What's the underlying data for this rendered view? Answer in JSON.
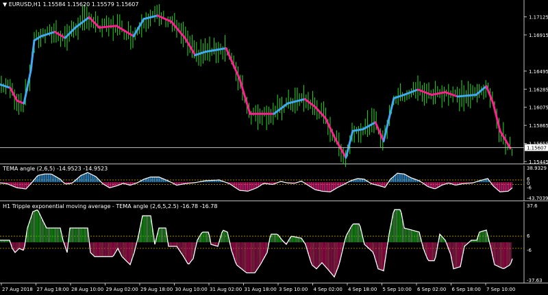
{
  "header": {
    "symbol_text": "EURUSD,H1",
    "ohlc_text": "1.15584 1.15620 1.15579 1.15607"
  },
  "main_panel": {
    "price_ticks": [
      "1.17125",
      "1.16915",
      "1.16495",
      "1.16285",
      "1.16075",
      "1.15865",
      "1.15655",
      "1.15445"
    ],
    "current_price_label": "1.15607",
    "colors": {
      "bull": "#3fa9f5",
      "bear": "#ff1f8e",
      "bars": "#22dd22"
    }
  },
  "indicator1": {
    "title": "TEMA angle (2,6,5)",
    "values_text": "-14.9523 -14.9523",
    "scale_labels": [
      "38.9329",
      "6",
      "0",
      "-6",
      "-43.7039"
    ],
    "colors": {
      "pos": "#3fa9f5",
      "neg": "#ff1f8e"
    }
  },
  "indicator2": {
    "title": "H1 Tripple exponential moving average - TEMA angle (2,6,5,2.5)",
    "values_text": "-16.78 -16.78",
    "scale_labels": [
      "37.6",
      "6",
      "-6",
      "-37.63"
    ],
    "colors": {
      "pos": "#22cc22",
      "neg": "#e01070"
    }
  },
  "time_axis": {
    "labels": [
      "27 Aug 2018",
      "27 Aug 18:00",
      "28 Aug 10:00",
      "29 Aug 02:00",
      "29 Aug 18:00",
      "30 Aug 10:00",
      "31 Aug 02:00",
      "31 Aug 18:00",
      "3 Sep 10:00",
      "4 Sep 02:00",
      "4 Sep 18:00",
      "5 Sep 10:00",
      "6 Sep 02:00",
      "6 Sep 18:00",
      "7 Sep 10:00"
    ]
  },
  "chart_data": {
    "type": "line",
    "price_series": [
      [
        0,
        1.1634
      ],
      [
        15,
        1.163
      ],
      [
        25,
        1.1615
      ],
      [
        35,
        1.1612
      ],
      [
        45,
        1.165
      ],
      [
        50,
        1.1685
      ],
      [
        60,
        1.169
      ],
      [
        80,
        1.1695
      ],
      [
        95,
        1.1688
      ],
      [
        110,
        1.17
      ],
      [
        130,
        1.1712
      ],
      [
        145,
        1.17
      ],
      [
        170,
        1.1702
      ],
      [
        195,
        1.169
      ],
      [
        210,
        1.171
      ],
      [
        230,
        1.1714
      ],
      [
        250,
        1.1707
      ],
      [
        270,
        1.1688
      ],
      [
        285,
        1.1668
      ],
      [
        300,
        1.1672
      ],
      [
        330,
        1.1676
      ],
      [
        350,
        1.164
      ],
      [
        365,
        1.16
      ],
      [
        400,
        1.16
      ],
      [
        420,
        1.1612
      ],
      [
        445,
        1.1617
      ],
      [
        460,
        1.1608
      ],
      [
        475,
        1.1595
      ],
      [
        490,
        1.157
      ],
      [
        505,
        1.1549
      ],
      [
        515,
        1.158
      ],
      [
        530,
        1.1582
      ],
      [
        548,
        1.159
      ],
      [
        560,
        1.1568
      ],
      [
        575,
        1.1618
      ],
      [
        590,
        1.1622
      ],
      [
        610,
        1.1628
      ],
      [
        630,
        1.1622
      ],
      [
        650,
        1.1625
      ],
      [
        668,
        1.162
      ],
      [
        695,
        1.1622
      ],
      [
        710,
        1.1632
      ],
      [
        720,
        1.1612
      ],
      [
        730,
        1.158
      ],
      [
        745,
        1.156
      ]
    ],
    "price_colors": [
      "bull",
      "bull",
      "bear",
      "bear",
      "bull",
      "bull",
      "bull",
      "bull",
      "bear",
      "bull",
      "bull",
      "bear",
      "bear",
      "bear",
      "bull",
      "bull",
      "bear",
      "bear",
      "bear",
      "bull",
      "bull",
      "bear",
      "bear",
      "bear",
      "bull",
      "bull",
      "bear",
      "bear",
      "bear",
      "bear",
      "bull",
      "bull",
      "bull",
      "bear",
      "bull",
      "bull",
      "bull",
      "bear",
      "bear",
      "bear",
      "bull",
      "bull",
      "bear",
      "bear",
      "bear"
    ],
    "price_range": [
      1.15445,
      1.17225
    ],
    "last_price": 1.15607,
    "ind1_range": [
      -43.7039,
      38.9329
    ],
    "ind1_nodes": [
      [
        0,
        -2
      ],
      [
        10,
        -4
      ],
      [
        25,
        -15
      ],
      [
        38,
        -18
      ],
      [
        45,
        -4
      ],
      [
        55,
        18
      ],
      [
        65,
        22
      ],
      [
        75,
        22
      ],
      [
        88,
        8
      ],
      [
        95,
        -5
      ],
      [
        105,
        -3
      ],
      [
        118,
        18
      ],
      [
        128,
        26
      ],
      [
        140,
        15
      ],
      [
        150,
        -4
      ],
      [
        160,
        -15
      ],
      [
        170,
        -10
      ],
      [
        180,
        -3
      ],
      [
        190,
        -8
      ],
      [
        200,
        -2
      ],
      [
        210,
        8
      ],
      [
        220,
        14
      ],
      [
        232,
        14
      ],
      [
        245,
        4
      ],
      [
        258,
        -8
      ],
      [
        270,
        -4
      ],
      [
        285,
        -1
      ],
      [
        300,
        4
      ],
      [
        320,
        6
      ],
      [
        335,
        -4
      ],
      [
        350,
        -22
      ],
      [
        362,
        -24
      ],
      [
        375,
        -15
      ],
      [
        385,
        -3
      ],
      [
        398,
        -6
      ],
      [
        410,
        2
      ],
      [
        420,
        -2
      ],
      [
        430,
        -3
      ],
      [
        440,
        3
      ],
      [
        460,
        -20
      ],
      [
        470,
        -24
      ],
      [
        482,
        -26
      ],
      [
        492,
        -15
      ],
      [
        502,
        -6
      ],
      [
        512,
        4
      ],
      [
        522,
        10
      ],
      [
        532,
        8
      ],
      [
        542,
        -4
      ],
      [
        555,
        -10
      ],
      [
        562,
        -14
      ],
      [
        570,
        8
      ],
      [
        580,
        24
      ],
      [
        590,
        22
      ],
      [
        600,
        12
      ],
      [
        612,
        4
      ],
      [
        625,
        -12
      ],
      [
        635,
        -18
      ],
      [
        645,
        -8
      ],
      [
        655,
        -2
      ],
      [
        665,
        -8
      ],
      [
        675,
        -4
      ],
      [
        690,
        -2
      ],
      [
        700,
        4
      ],
      [
        712,
        10
      ],
      [
        720,
        -10
      ],
      [
        730,
        -26
      ],
      [
        742,
        -24
      ],
      [
        748,
        -15
      ]
    ],
    "ind2_range": [
      -37.63,
      37.6
    ],
    "ind2_nodes": [
      [
        0,
        2
      ],
      [
        14,
        2
      ],
      [
        18,
        -6
      ],
      [
        22,
        -10
      ],
      [
        28,
        -6
      ],
      [
        35,
        -8
      ],
      [
        40,
        14
      ],
      [
        48,
        30
      ],
      [
        55,
        32
      ],
      [
        62,
        22
      ],
      [
        68,
        14
      ],
      [
        88,
        14
      ],
      [
        92,
        2
      ],
      [
        98,
        -10
      ],
      [
        102,
        14
      ],
      [
        110,
        14
      ],
      [
        120,
        14
      ],
      [
        128,
        14
      ],
      [
        132,
        -10
      ],
      [
        138,
        -14
      ],
      [
        150,
        -14
      ],
      [
        165,
        -14
      ],
      [
        172,
        -6
      ],
      [
        178,
        -14
      ],
      [
        190,
        -22
      ],
      [
        196,
        -10
      ],
      [
        202,
        6
      ],
      [
        208,
        26
      ],
      [
        220,
        26
      ],
      [
        226,
        -2
      ],
      [
        232,
        14
      ],
      [
        242,
        14
      ],
      [
        246,
        -4
      ],
      [
        258,
        -4
      ],
      [
        268,
        -14
      ],
      [
        275,
        -22
      ],
      [
        282,
        -16
      ],
      [
        288,
        2
      ],
      [
        295,
        10
      ],
      [
        305,
        10
      ],
      [
        308,
        -2
      ],
      [
        318,
        -4
      ],
      [
        325,
        12
      ],
      [
        332,
        10
      ],
      [
        338,
        -8
      ],
      [
        345,
        -22
      ],
      [
        360,
        -30
      ],
      [
        372,
        -30
      ],
      [
        380,
        -22
      ],
      [
        390,
        -10
      ],
      [
        395,
        8
      ],
      [
        405,
        8
      ],
      [
        412,
        2
      ],
      [
        418,
        -2
      ],
      [
        425,
        6
      ],
      [
        440,
        4
      ],
      [
        446,
        -2
      ],
      [
        455,
        -22
      ],
      [
        462,
        -26
      ],
      [
        470,
        -20
      ],
      [
        478,
        -26
      ],
      [
        488,
        -34
      ],
      [
        495,
        -22
      ],
      [
        505,
        6
      ],
      [
        515,
        18
      ],
      [
        525,
        18
      ],
      [
        532,
        -2
      ],
      [
        545,
        -10
      ],
      [
        552,
        -26
      ],
      [
        560,
        -28
      ],
      [
        568,
        8
      ],
      [
        575,
        32
      ],
      [
        585,
        32
      ],
      [
        590,
        14
      ],
      [
        612,
        10
      ],
      [
        618,
        -6
      ],
      [
        625,
        -18
      ],
      [
        635,
        -18
      ],
      [
        642,
        8
      ],
      [
        650,
        2
      ],
      [
        658,
        -12
      ],
      [
        662,
        -26
      ],
      [
        672,
        -24
      ],
      [
        678,
        -4
      ],
      [
        688,
        2
      ],
      [
        696,
        2
      ],
      [
        700,
        10
      ],
      [
        710,
        12
      ],
      [
        716,
        -4
      ],
      [
        722,
        -22
      ],
      [
        735,
        -26
      ],
      [
        745,
        -22
      ],
      [
        748,
        -16
      ]
    ]
  }
}
